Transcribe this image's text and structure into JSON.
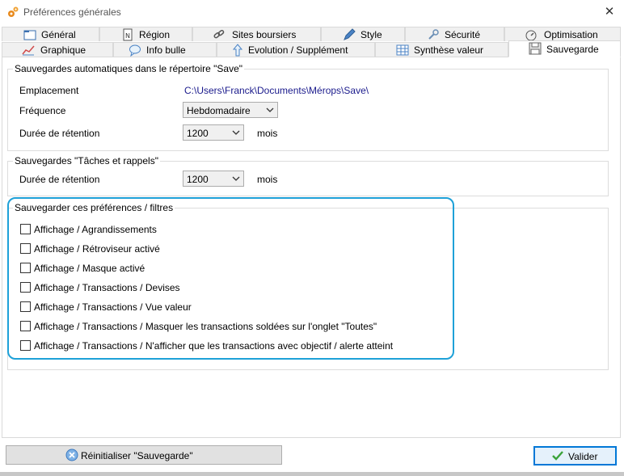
{
  "window": {
    "title": "Préférences générales",
    "close_glyph": "✕"
  },
  "tabs_row1": [
    {
      "label": "Général",
      "icon": "folder-icon"
    },
    {
      "label": "Région",
      "icon": "notepad-icon"
    },
    {
      "label": "Sites boursiers",
      "icon": "link-icon"
    },
    {
      "label": "Style",
      "icon": "pencil-icon"
    },
    {
      "label": "Sécurité",
      "icon": "wrench-icon"
    },
    {
      "label": "Optimisation",
      "icon": "gauge-icon"
    }
  ],
  "tabs_row2": [
    {
      "label": "Graphique",
      "icon": "chart-icon"
    },
    {
      "label": "Info bulle",
      "icon": "speech-bubble-icon"
    },
    {
      "label": "Evolution / Supplément",
      "icon": "arrow-up-icon"
    },
    {
      "label": "Synthèse valeur",
      "icon": "grid-icon"
    },
    {
      "label": "Sauvegarde",
      "icon": "floppy-disk-icon",
      "active": true
    }
  ],
  "auto_save": {
    "title": "Sauvegardes automatiques dans le répertoire \"Save\"",
    "location_label": "Emplacement",
    "location_value": "C:\\Users\\Franck\\Documents\\Mérops\\Save\\",
    "frequency_label": "Fréquence",
    "frequency_value": "Hebdomadaire",
    "retention_label": "Durée de rétention",
    "retention_value": "1200",
    "retention_unit": "mois"
  },
  "tasks": {
    "title": "Sauvegardes \"Tâches et rappels\"",
    "retention_label": "Durée de rétention",
    "retention_value": "1200",
    "retention_unit": "mois"
  },
  "prefs": {
    "title": "Sauvegarder ces préférences / filtres",
    "items": [
      {
        "label": "Affichage / Agrandissements",
        "checked": false
      },
      {
        "label": "Affichage / Rétroviseur activé",
        "checked": false
      },
      {
        "label": "Affichage / Masque activé",
        "checked": false
      },
      {
        "label": "Affichage / Transactions / Devises",
        "checked": false
      },
      {
        "label": "Affichage / Transactions / Vue valeur",
        "checked": false
      },
      {
        "label": "Affichage / Transactions / Masquer les transactions soldées sur l'onglet \"Toutes\"",
        "checked": false
      },
      {
        "label": "Affichage / Transactions / N'afficher que les transactions avec objectif / alerte atteint",
        "checked": false
      }
    ]
  },
  "footer": {
    "reset_label": "Réinitialiser \"Sauvegarde\"",
    "validate_label": "Valider"
  },
  "colors": {
    "highlight": "#1ea1d8",
    "path_text": "#1a1a8c",
    "primary_border": "#0078d7"
  }
}
